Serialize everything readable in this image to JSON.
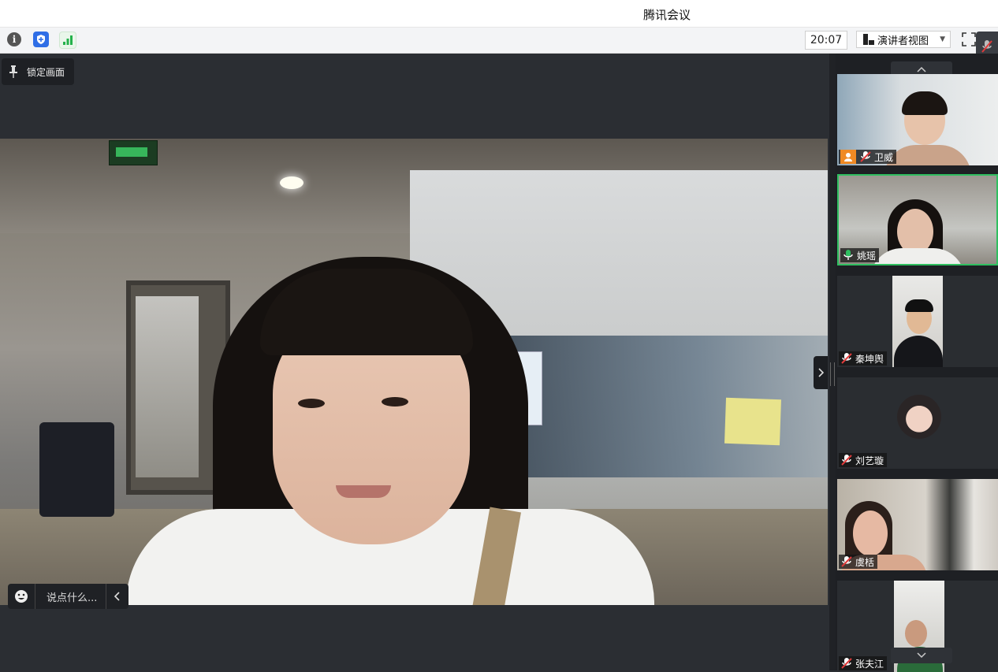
{
  "window": {
    "title": "腾讯会议"
  },
  "toolbar": {
    "time": "20:07",
    "view_label": "演讲者视图",
    "icons": [
      "info-icon",
      "shield-icon",
      "signal-icon",
      "fullscreen-icon"
    ]
  },
  "stage": {
    "lock_label": "锁定画面",
    "chat_placeholder": "说点什么..."
  },
  "participants": [
    {
      "name": "卫威",
      "host": true,
      "muted": true
    },
    {
      "name": "姚瑶",
      "host": false,
      "muted": false,
      "speaking": true
    },
    {
      "name": "秦坤舆",
      "host": false,
      "muted": true
    },
    {
      "name": "刘艺璇",
      "host": false,
      "muted": true
    },
    {
      "name": "虞栝",
      "host": false,
      "muted": true
    },
    {
      "name": "张夫江",
      "host": false,
      "muted": true
    }
  ],
  "colors": {
    "accent_green": "#2fbf60",
    "host_orange": "#f08a24",
    "mute_red": "#e03b3b"
  }
}
